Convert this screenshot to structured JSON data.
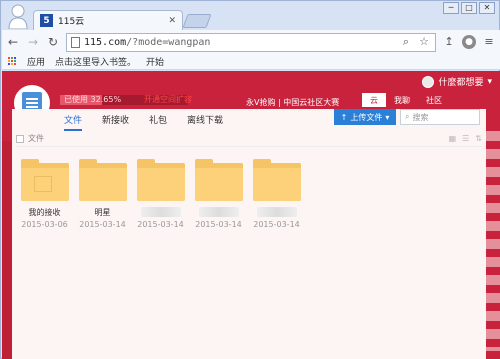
{
  "browser": {
    "tab_title": "115云",
    "tab_favicon": "5",
    "url_host": "115.com",
    "url_path": "/?mode=wangpan",
    "window_controls": [
      "─",
      "□",
      "✕"
    ]
  },
  "bookmarks": {
    "apps_label": "应用",
    "import_label": "点击这里导入书签。",
    "start_label": "开始"
  },
  "header": {
    "user_name": "什麼都想要",
    "usage_label": "已使用 32.65%",
    "usage_fraction": 0.3265,
    "usage_link": "开通空间扩容",
    "promo_text": "永V抢购 | 中国云社区大赛",
    "nav_links": [
      "云",
      "我聊",
      "社区"
    ]
  },
  "panel": {
    "tabs": [
      "文件",
      "新接收",
      "礼包",
      "离线下载"
    ],
    "active_tab": 0,
    "upload_label": "上传文件",
    "search_placeholder": "搜索",
    "select_all_label": "文件"
  },
  "files": [
    {
      "name": "我的接收",
      "date": "2015-03-06",
      "blurred": false,
      "gift": true
    },
    {
      "name": "明星",
      "date": "2015-03-14",
      "blurred": false,
      "gift": false
    },
    {
      "name": "",
      "date": "2015-03-14",
      "blurred": true,
      "gift": false
    },
    {
      "name": "",
      "date": "2015-03-14",
      "blurred": true,
      "gift": false
    },
    {
      "name": "",
      "date": "2015-03-14",
      "blurred": true,
      "gift": false
    }
  ],
  "colors": {
    "brand_red": "#c9223c",
    "folder_yellow": "#fcd17a",
    "accent_blue": "#2a7fd7"
  }
}
